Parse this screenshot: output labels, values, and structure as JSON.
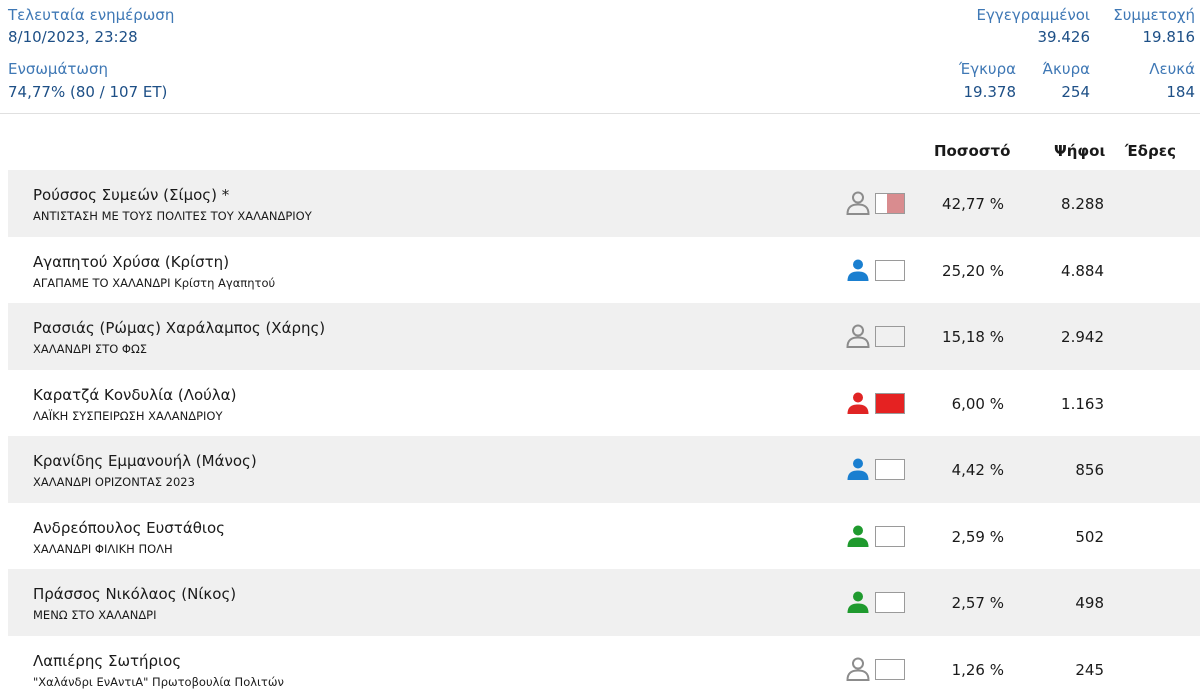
{
  "header": {
    "last_update_label": "Τελευταία ενημέρωση",
    "last_update_value": "8/10/2023, 23:28",
    "integration_label": "Ενσωμάτωση",
    "integration_value": "74,77% (80 / 107 ΕΤ)",
    "registered_label": "Εγγεγραμμένοι",
    "registered_value": "39.426",
    "turnout_label": "Συμμετοχή",
    "turnout_value": "19.816",
    "valid_label": "Έγκυρα",
    "valid_value": "19.378",
    "invalid_label": "Άκυρα",
    "invalid_value": "254",
    "blank_label": "Λευκά",
    "blank_value": "184"
  },
  "table": {
    "columns": {
      "percent": "Ποσοστό",
      "votes": "Ψήφοι",
      "seats": "Έδρες"
    },
    "rows": [
      {
        "name": "Ρούσσος Συμεών (Σίμος) *",
        "party": "ΑΝΤΙΣΤΑΣΗ ΜΕ ΤΟΥΣ ΠΟΛΙΤΕΣ ΤΟΥ ΧΑΛΑΝΔΡΙΟΥ",
        "percent": "42,77 %",
        "votes": "8.288",
        "icon_color": "#8c8c8c",
        "swatch_color": "#d98c8f",
        "swatch_fill": 0.6
      },
      {
        "name": "Αγαπητού Χρύσα (Κρίστη)",
        "party": "ΑΓΑΠΑΜΕ ΤΟ ΧΑΛΑΝΔΡΙ Κρίστη Αγαπητού",
        "percent": "25,20 %",
        "votes": "4.884",
        "icon_color": "#1a7fd0",
        "swatch_color": "#ffffff",
        "swatch_fill": 0
      },
      {
        "name": "Ρασσιάς (Ρώμας) Χαράλαμπος (Χάρης)",
        "party": "ΧΑΛΑΝΔΡΙ ΣΤΟ ΦΩΣ",
        "percent": "15,18 %",
        "votes": "2.942",
        "icon_color": "#8c8c8c",
        "swatch_color": "#f0f0f0",
        "swatch_fill": 1
      },
      {
        "name": "Καρατζά Κονδυλία (Λούλα)",
        "party": "ΛΑΪΚΗ ΣΥΣΠΕΙΡΩΣΗ ΧΑΛΑΝΔΡΙΟΥ",
        "percent": "6,00 %",
        "votes": "1.163",
        "icon_color": "#e02424",
        "swatch_color": "#e52222",
        "swatch_fill": 1
      },
      {
        "name": "Κρανίδης Εμμανουήλ (Μάνος)",
        "party": "ΧΑΛΑΝΔΡΙ ΟΡΙΖΟΝΤΑΣ 2023",
        "percent": "4,42 %",
        "votes": "856",
        "icon_color": "#1a7fd0",
        "swatch_color": "#ffffff",
        "swatch_fill": 0
      },
      {
        "name": "Ανδρεόπουλος Ευστάθιος",
        "party": "ΧΑΛΑΝΔΡΙ ΦΙΛΙΚΗ ΠΟΛΗ",
        "percent": "2,59 %",
        "votes": "502",
        "icon_color": "#1f9a2e",
        "swatch_color": "#ffffff",
        "swatch_fill": 0
      },
      {
        "name": "Πράσσος Νικόλαος (Νίκος)",
        "party": "ΜΕΝΩ ΣΤΟ ΧΑΛΑΝΔΡΙ",
        "percent": "2,57 %",
        "votes": "498",
        "icon_color": "#1f9a2e",
        "swatch_color": "#ffffff",
        "swatch_fill": 0
      },
      {
        "name": "Λαπιέρης Σωτήριος",
        "party": "\"Χαλάνδρι ΕνΑντιΑ\" Πρωτοβουλία Πολιτών",
        "percent": "1,26 %",
        "votes": "245",
        "icon_color": "#8c8c8c",
        "swatch_color": "#ffffff",
        "swatch_fill": 0
      }
    ]
  }
}
